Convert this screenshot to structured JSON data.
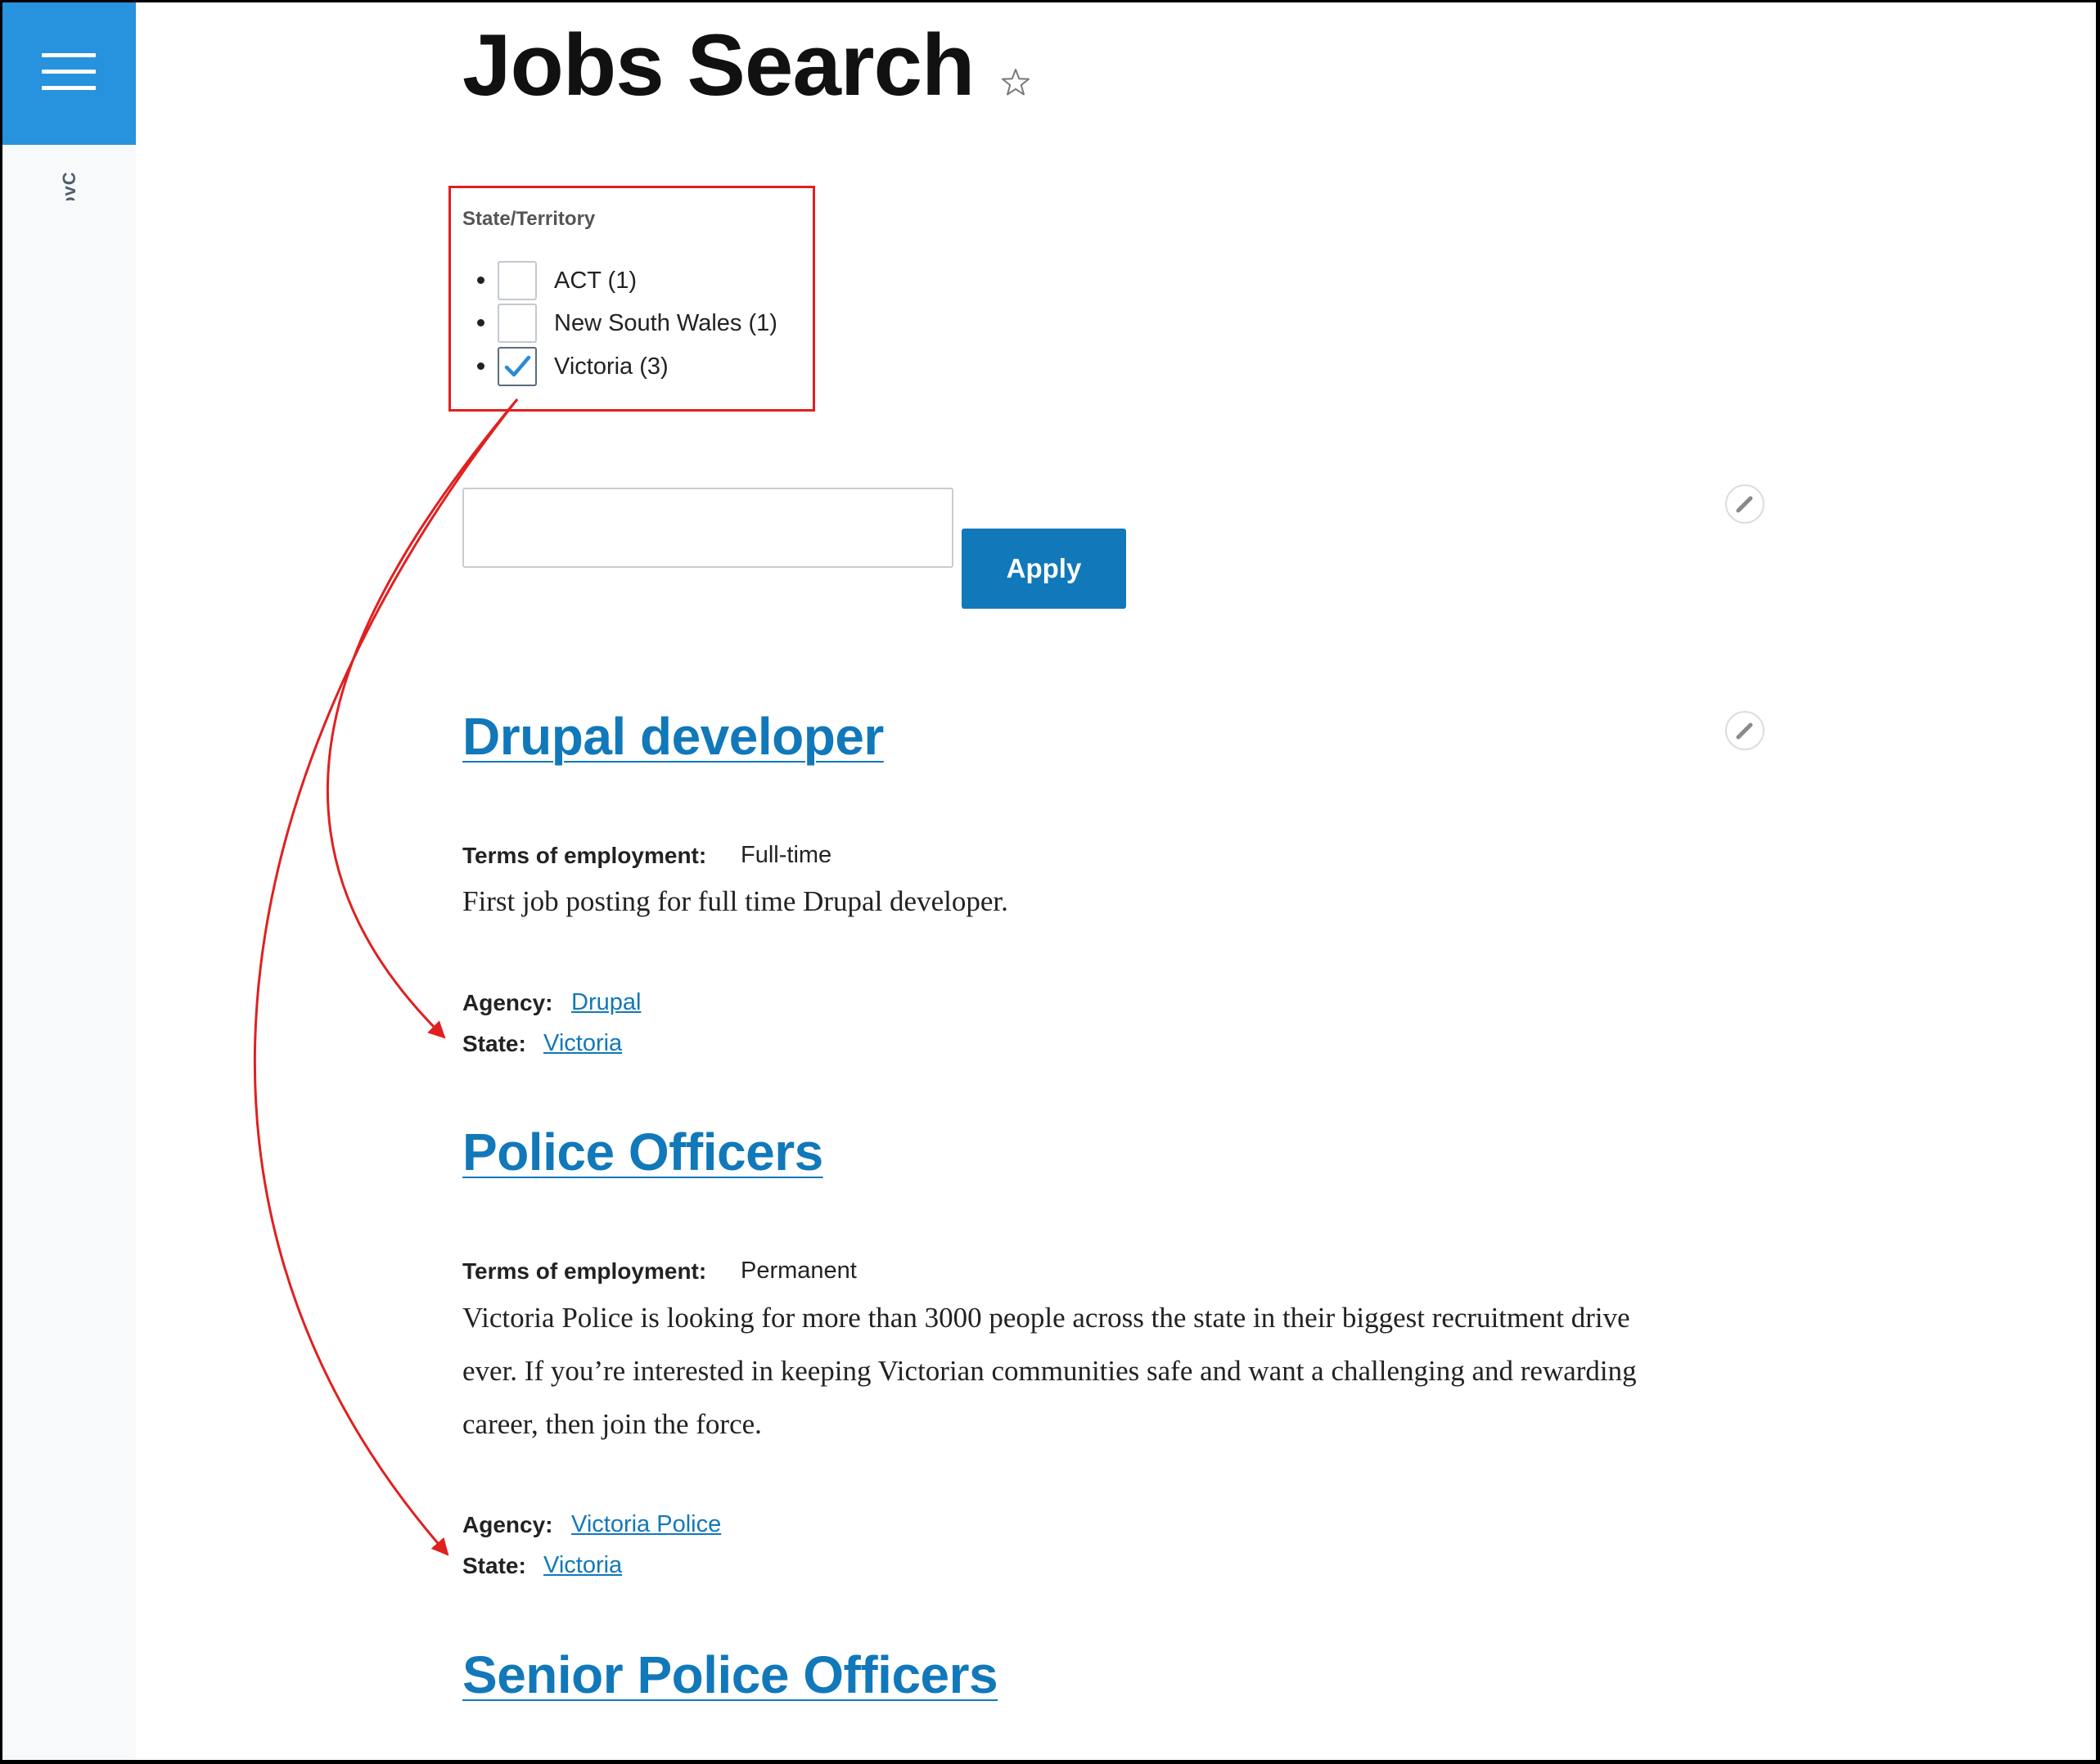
{
  "sidebar": {
    "brand_text": "GovC"
  },
  "header": {
    "title": "Jobs Search"
  },
  "facet": {
    "title": "State/Territory",
    "items": [
      {
        "label": "ACT (1)",
        "checked": false
      },
      {
        "label": "New South Wales (1)",
        "checked": false
      },
      {
        "label": "Victoria (3)",
        "checked": true
      }
    ]
  },
  "search": {
    "value": "",
    "apply_label": "Apply"
  },
  "jobs": [
    {
      "title": "Drupal developer",
      "terms_label": "Terms of employment:",
      "terms_value": "Full-time",
      "description": [
        "First job posting for full time Drupal developer."
      ],
      "agency_label": "Agency:",
      "agency_value": "Drupal",
      "state_label": "State:",
      "state_value": "Victoria"
    },
    {
      "title": "Police Officers",
      "terms_label": "Terms of employment:",
      "terms_value": "Permanent",
      "description": [
        "Victoria Police is looking for more than 3000 people across the state in their biggest recruitment drive",
        "ever. If you’re interested in keeping Victorian communities safe and want a challenging and rewarding",
        "career, then join the force."
      ],
      "agency_label": "Agency:",
      "agency_value": "Victoria Police",
      "state_label": "State:",
      "state_value": "Victoria"
    },
    {
      "title": "Senior Police Officers"
    }
  ],
  "colors": {
    "menu_button": "#2792dd",
    "link": "#1178ba",
    "apply_button": "#1178ba",
    "annotation": "#e02020"
  },
  "icons": {
    "menu": "hamburger-icon",
    "bookmark": "star-icon",
    "edit": "pencil-icon",
    "checked": "checkmark-icon"
  }
}
